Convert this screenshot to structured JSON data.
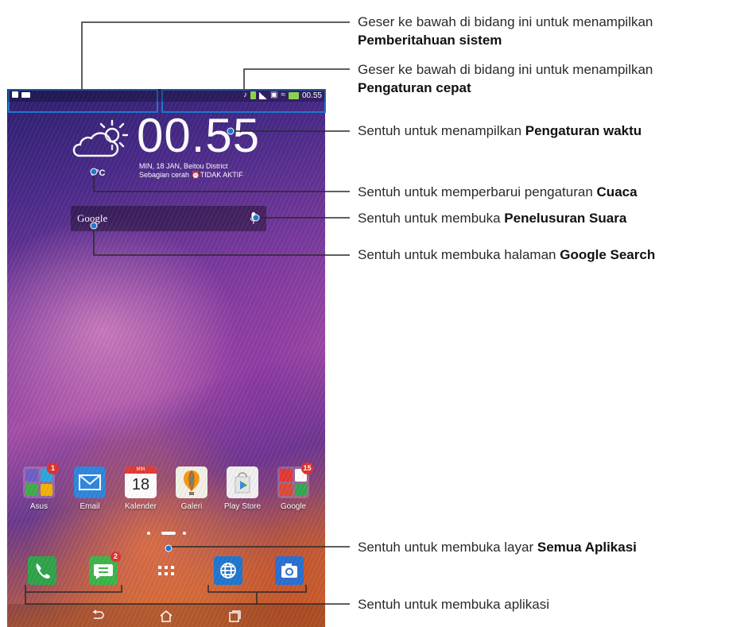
{
  "status_bar": {
    "time": "00.55"
  },
  "clock_widget": {
    "time": "00.55",
    "date_location": "MIN, 18 JAN, Beitou District",
    "weather_alarm": "Sebagian cerah  ⏰TIDAK AKTIF",
    "temperature": "0°C",
    "weather_icon": "partly-cloudy-icon"
  },
  "search_bar": {
    "label": "Google",
    "icon": "mic-icon"
  },
  "apps": [
    {
      "label": "Asus",
      "icon": "folder-icon",
      "badge": "1"
    },
    {
      "label": "Email",
      "icon": "envelope-icon"
    },
    {
      "label": "Kalender",
      "icon": "calendar-icon",
      "month": "MIN",
      "day": "18"
    },
    {
      "label": "Galeri",
      "icon": "balloon-icon"
    },
    {
      "label": "Play Store",
      "icon": "play-store-icon"
    },
    {
      "label": "Google",
      "icon": "folder-icon",
      "badge": "15"
    }
  ],
  "dock": [
    {
      "icon": "phone-icon"
    },
    {
      "icon": "messages-icon",
      "badge": "2"
    },
    {
      "icon": "all-apps-icon"
    },
    {
      "icon": "browser-icon"
    },
    {
      "icon": "camera-icon"
    }
  ],
  "nav": [
    "back-icon",
    "home-icon",
    "recents-icon"
  ],
  "colors": {
    "accent_green": "#2fa44a",
    "accent_blue": "#1f77d0",
    "badge_red": "#e0322e"
  },
  "callouts": [
    {
      "pre": "Geser ke bawah di bidang ini untuk menampilkan",
      "bold": "Pemberitahuan sistem"
    },
    {
      "pre": "Geser ke bawah di bidang ini untuk menampilkan",
      "bold": "Pengaturan cepat"
    },
    {
      "pre": "Sentuh untuk menampilkan ",
      "bold": "Pengaturan waktu"
    },
    {
      "pre": "Sentuh untuk memperbarui pengaturan ",
      "bold": "Cuaca"
    },
    {
      "pre": "Sentuh untuk membuka ",
      "bold": "Penelusuran Suara"
    },
    {
      "pre": "Sentuh untuk membuka halaman ",
      "bold": "Google Search"
    },
    {
      "pre": "Sentuh untuk membuka layar ",
      "bold": "Semua Aplikasi"
    },
    {
      "pre": "Sentuh untuk membuka aplikasi",
      "bold": ""
    }
  ]
}
